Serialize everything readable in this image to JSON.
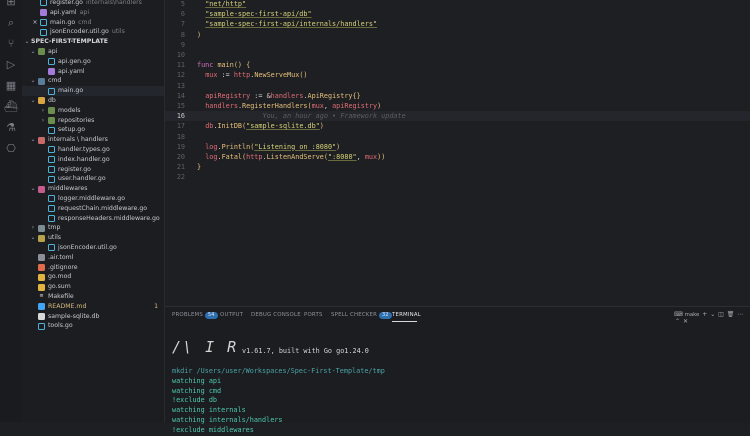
{
  "activity_bar": {
    "icons": [
      "explorer-icon",
      "search-icon",
      "source-control-icon",
      "run-debug-icon",
      "extensions-icon",
      "docker-icon",
      "testing-icon",
      "remote-explorer-icon"
    ]
  },
  "explorer": {
    "open_editors": [
      {
        "name": "register.go",
        "desc": "internals\\handlers",
        "type": "go"
      },
      {
        "name": "api.yaml",
        "desc": "api",
        "type": "yml"
      },
      {
        "name": "main.go",
        "desc": "cmd",
        "type": "go",
        "close": "×"
      },
      {
        "name": "jsonEncoder.util.go",
        "desc": "utils",
        "type": "go"
      }
    ],
    "project_title": "SPEC-FIRST-TEMPLATE",
    "tree": [
      {
        "name": "api",
        "kind": "folder",
        "depth": 0,
        "open": true,
        "chev": "⌄"
      },
      {
        "name": "api.gen.go",
        "kind": "go",
        "depth": 1
      },
      {
        "name": "api.yaml",
        "kind": "yml",
        "depth": 1
      },
      {
        "name": "cmd",
        "kind": "folder-cmd",
        "depth": 0,
        "open": true,
        "chev": "⌄"
      },
      {
        "name": "main.go",
        "kind": "go",
        "depth": 1,
        "selected": true
      },
      {
        "name": "db",
        "kind": "folder-db",
        "depth": 0,
        "open": true,
        "chev": "⌄"
      },
      {
        "name": "models",
        "kind": "folder",
        "depth": 1,
        "open": false,
        "chev": "›"
      },
      {
        "name": "repositories",
        "kind": "folder",
        "depth": 1,
        "open": false,
        "chev": "›"
      },
      {
        "name": "setup.go",
        "kind": "go",
        "depth": 1
      },
      {
        "name": "internals \\ handlers",
        "kind": "folder-int",
        "depth": 0,
        "open": true,
        "chev": "⌄"
      },
      {
        "name": "handler.types.go",
        "kind": "go",
        "depth": 1
      },
      {
        "name": "index.handler.go",
        "kind": "go",
        "depth": 1
      },
      {
        "name": "register.go",
        "kind": "go",
        "depth": 1
      },
      {
        "name": "user.handler.go",
        "kind": "go",
        "depth": 1
      },
      {
        "name": "middlewares",
        "kind": "folder-mid",
        "depth": 0,
        "open": true,
        "chev": "⌄"
      },
      {
        "name": "logger.middleware.go",
        "kind": "go",
        "depth": 1
      },
      {
        "name": "requestChain.middleware.go",
        "kind": "go",
        "depth": 1
      },
      {
        "name": "responseHeaders.middleware.go",
        "kind": "go",
        "depth": 1
      },
      {
        "name": "tmp",
        "kind": "folder-tmp",
        "depth": 0,
        "open": false,
        "chev": "›"
      },
      {
        "name": "utils",
        "kind": "folder-util",
        "depth": 0,
        "open": true,
        "chev": "⌄"
      },
      {
        "name": "jsonEncoder.util.go",
        "kind": "go",
        "depth": 1
      },
      {
        "name": ".air.toml",
        "kind": "toml",
        "depth": 0
      },
      {
        "name": ".gitignore",
        "kind": "git",
        "depth": 0
      },
      {
        "name": "go.mod",
        "kind": "mod",
        "depth": 0
      },
      {
        "name": "go.sum",
        "kind": "mod",
        "depth": 0
      },
      {
        "name": "Makefile",
        "kind": "make",
        "depth": 0
      },
      {
        "name": "README.md",
        "kind": "md",
        "depth": 0,
        "badge": "1",
        "modified": true
      },
      {
        "name": "sample-sqlite.db",
        "kind": "db",
        "depth": 0
      },
      {
        "name": "tools.go",
        "kind": "go",
        "depth": 0
      }
    ]
  },
  "editor": {
    "current_line": 16,
    "lines": [
      {
        "n": "5",
        "tokens": [
          {
            "t": "  ",
            "c": "punc"
          },
          {
            "t": "\"net/http\"",
            "c": "str"
          }
        ]
      },
      {
        "n": "6",
        "tokens": [
          {
            "t": "  ",
            "c": "punc"
          },
          {
            "t": "\"sample-spec-first-api/db\"",
            "c": "str"
          }
        ]
      },
      {
        "n": "7",
        "tokens": [
          {
            "t": "  ",
            "c": "punc"
          },
          {
            "t": "\"sample-spec-first-api/internals/handlers\"",
            "c": "str"
          }
        ]
      },
      {
        "n": "8",
        "tokens": [
          {
            "t": ")",
            "c": "paren"
          }
        ]
      },
      {
        "n": "9",
        "tokens": []
      },
      {
        "n": "10",
        "tokens": []
      },
      {
        "n": "11",
        "tokens": [
          {
            "t": "func ",
            "c": "kw"
          },
          {
            "t": "main",
            "c": "fn"
          },
          {
            "t": "() {",
            "c": "paren"
          }
        ]
      },
      {
        "n": "12",
        "tokens": [
          {
            "t": "  ",
            "c": "punc"
          },
          {
            "t": "mux",
            "c": "id"
          },
          {
            "t": " := ",
            "c": "punc"
          },
          {
            "t": "http",
            "c": "pkg"
          },
          {
            "t": ".",
            "c": "punc"
          },
          {
            "t": "NewServeMux",
            "c": "fn"
          },
          {
            "t": "()",
            "c": "paren"
          }
        ]
      },
      {
        "n": "13",
        "tokens": []
      },
      {
        "n": "14",
        "tokens": [
          {
            "t": "  ",
            "c": "punc"
          },
          {
            "t": "apiRegistry",
            "c": "id"
          },
          {
            "t": " := &",
            "c": "punc"
          },
          {
            "t": "handlers",
            "c": "pkg"
          },
          {
            "t": ".",
            "c": "punc"
          },
          {
            "t": "ApiRegistry",
            "c": "type"
          },
          {
            "t": "{}",
            "c": "paren"
          }
        ]
      },
      {
        "n": "15",
        "tokens": [
          {
            "t": "  ",
            "c": "punc"
          },
          {
            "t": "handlers",
            "c": "pkg"
          },
          {
            "t": ".",
            "c": "punc"
          },
          {
            "t": "RegisterHandlers",
            "c": "fn"
          },
          {
            "t": "(",
            "c": "paren"
          },
          {
            "t": "mux",
            "c": "id"
          },
          {
            "t": ", ",
            "c": "punc"
          },
          {
            "t": "apiRegistry",
            "c": "id"
          },
          {
            "t": ")",
            "c": "paren"
          }
        ]
      },
      {
        "n": "16",
        "tokens": [
          {
            "t": "                You, an hour ago • Framework update",
            "c": "ghost"
          }
        ]
      },
      {
        "n": "17",
        "tokens": [
          {
            "t": "  ",
            "c": "punc"
          },
          {
            "t": "db",
            "c": "pkg"
          },
          {
            "t": ".",
            "c": "punc"
          },
          {
            "t": "InitDB",
            "c": "fn"
          },
          {
            "t": "(",
            "c": "paren"
          },
          {
            "t": "\"sample-sqlite.db\"",
            "c": "str"
          },
          {
            "t": ")",
            "c": "paren"
          }
        ]
      },
      {
        "n": "18",
        "tokens": []
      },
      {
        "n": "19",
        "tokens": [
          {
            "t": "  ",
            "c": "punc"
          },
          {
            "t": "log",
            "c": "pkg"
          },
          {
            "t": ".",
            "c": "punc"
          },
          {
            "t": "Println",
            "c": "fn"
          },
          {
            "t": "(",
            "c": "paren"
          },
          {
            "t": "\"Listening on :8080\"",
            "c": "str"
          },
          {
            "t": ")",
            "c": "paren"
          }
        ]
      },
      {
        "n": "20",
        "tokens": [
          {
            "t": "  ",
            "c": "punc"
          },
          {
            "t": "log",
            "c": "pkg"
          },
          {
            "t": ".",
            "c": "punc"
          },
          {
            "t": "Fatal",
            "c": "fn"
          },
          {
            "t": "(",
            "c": "paren"
          },
          {
            "t": "http",
            "c": "pkg"
          },
          {
            "t": ".",
            "c": "punc"
          },
          {
            "t": "ListenAndServe",
            "c": "fn"
          },
          {
            "t": "(",
            "c": "paren"
          },
          {
            "t": "\":8080\"",
            "c": "str"
          },
          {
            "t": ", ",
            "c": "punc"
          },
          {
            "t": "mux",
            "c": "id"
          },
          {
            "t": "))",
            "c": "paren"
          }
        ]
      },
      {
        "n": "21",
        "tokens": [
          {
            "t": "}",
            "c": "paren"
          }
        ]
      },
      {
        "n": "22",
        "tokens": []
      }
    ]
  },
  "panel": {
    "tabs": [
      {
        "label": "PROBLEMS",
        "badge": "54",
        "active": false
      },
      {
        "label": "OUTPUT",
        "active": false
      },
      {
        "label": "DEBUG CONSOLE",
        "active": false
      },
      {
        "label": "PORTS",
        "active": false
      },
      {
        "label": "SPELL CHECKER",
        "badge": "32",
        "active": false
      },
      {
        "label": "TERMINAL",
        "active": true
      }
    ],
    "terminal_name": "make",
    "tool_icons": [
      "add-terminal-icon",
      "dropdown-icon",
      "split-terminal-icon",
      "kill-terminal-icon",
      "more-actions-icon",
      "maximize-panel-icon",
      "close-panel-icon"
    ],
    "terminal": {
      "logo": "/\\ I R",
      "version_line": "v1.61.7, built with Go go1.24.0",
      "lines": [
        {
          "text": "mkdir /Users/user/Workspaces/Spec-First-Template/tmp",
          "c": "mkdir"
        },
        {
          "text": "watching api",
          "c": "green"
        },
        {
          "text": "watching cmd",
          "c": "green"
        },
        {
          "text": "!exclude db",
          "c": "green"
        },
        {
          "text": "watching internals",
          "c": "green"
        },
        {
          "text": "watching internals/handlers",
          "c": "green"
        },
        {
          "text": "!exclude middlewares",
          "c": "green"
        }
      ]
    }
  },
  "colors": {
    "accent": "#2f6fb0",
    "string": "#d7d27a",
    "keyword": "#d16ebd",
    "function": "#e5c07b",
    "variable": "#e06c75",
    "terminal_green": "#4ec9b0"
  }
}
